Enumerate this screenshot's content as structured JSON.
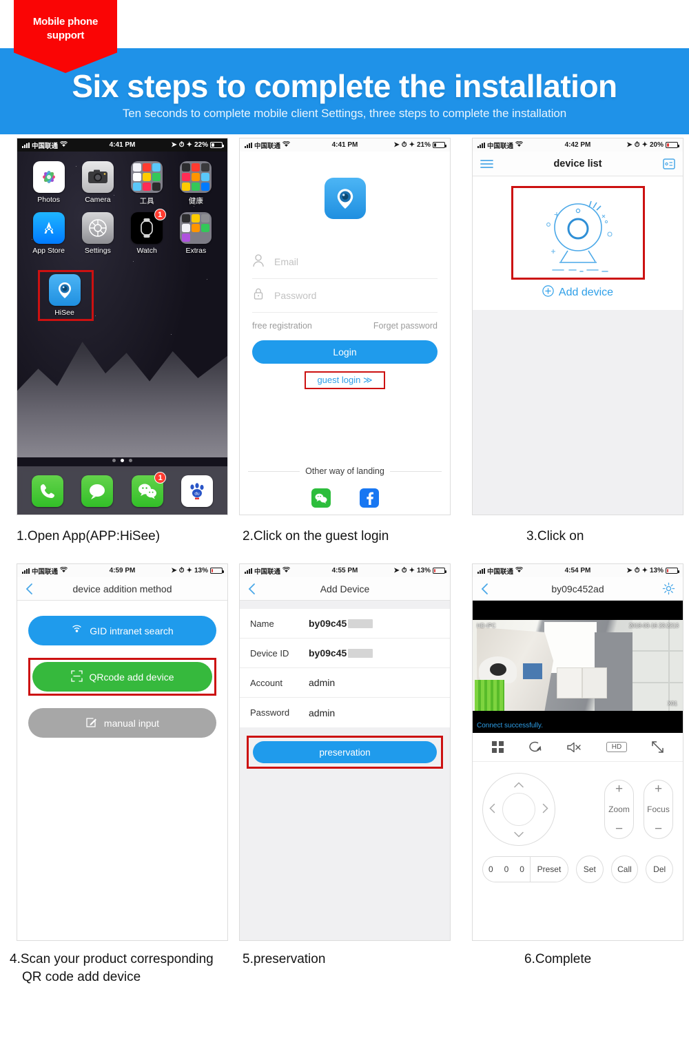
{
  "banner": {
    "ribbon_line1": "Mobile phone",
    "ribbon_line2": "support",
    "title": "Six steps to complete the installation",
    "subtitle": "Ten seconds to complete mobile client Settings, three steps to complete the installation",
    "blue": "#1f92e8",
    "red": "#fa0505"
  },
  "captions": {
    "step1": "1.Open App(APP:HiSee)",
    "step2": "2.Click on the guest login",
    "step3": "3.Click on",
    "step4_line1": "4.Scan your product corresponding",
    "step4_line2": "QR code add device",
    "step5": "5.preservation",
    "step6": "6.Complete"
  },
  "phone1": {
    "status": {
      "carrier": "中国联通",
      "time": "4:41 PM",
      "battery": "22%"
    },
    "apps_row1": [
      {
        "label": "Photos",
        "icon": "photos-icon"
      },
      {
        "label": "Camera",
        "icon": "camera-icon"
      },
      {
        "label": "工具",
        "icon": "folder-icon"
      },
      {
        "label": "健康",
        "icon": "folder-icon"
      }
    ],
    "apps_row2": [
      {
        "label": "App Store",
        "icon": "app-store-icon"
      },
      {
        "label": "Settings",
        "icon": "settings-icon"
      },
      {
        "label": "Watch",
        "icon": "watch-icon",
        "badge": "1"
      },
      {
        "label": "Extras",
        "icon": "folder-icon"
      }
    ],
    "highlighted_app": {
      "label": "HiSee",
      "icon": "hisee-icon"
    },
    "dock": [
      {
        "label": "Phone",
        "icon": "phone-icon"
      },
      {
        "label": "Messages",
        "icon": "messages-icon"
      },
      {
        "label": "WeChat",
        "icon": "wechat-icon",
        "badge": "1"
      },
      {
        "label": "Baidu",
        "icon": "baidu-icon"
      }
    ]
  },
  "phone2": {
    "status": {
      "carrier": "中国联通",
      "time": "4:41 PM",
      "battery": "21%"
    },
    "email_placeholder": "Email",
    "password_placeholder": "Password",
    "free_registration": "free registration",
    "forget_password": "Forget password",
    "login_button": "Login",
    "guest_login": "guest login",
    "guest_chevron": "≫",
    "other_way": "Other way of landing",
    "socials": [
      {
        "name": "wechat-icon"
      },
      {
        "name": "facebook-icon"
      }
    ]
  },
  "phone3": {
    "status": {
      "carrier": "中国联通",
      "time": "4:42 PM",
      "battery": "20%"
    },
    "nav_title": "device list",
    "menu_icon": "hamburger-icon",
    "right_icon": "list-view-icon",
    "add_device": "Add device"
  },
  "phone4": {
    "status": {
      "carrier": "中国联通",
      "time": "4:59 PM",
      "battery": "13%"
    },
    "nav_title": "device addition method",
    "back_icon": "back-chevron-icon",
    "buttons": [
      {
        "label": "GID intranet search",
        "icon": "wifi-signal-icon",
        "color": "#1f9bec"
      },
      {
        "label": "QRcode add device",
        "icon": "qr-scan-icon",
        "color": "#36b93d"
      },
      {
        "label": "manual input",
        "icon": "pencil-square-icon",
        "color": "#a7a7a7"
      }
    ]
  },
  "phone5": {
    "status": {
      "carrier": "中国联通",
      "time": "4:55 PM",
      "battery": "13%"
    },
    "nav_title": "Add Device",
    "back_icon": "back-chevron-icon",
    "fields": [
      {
        "key": "Name",
        "value": "by09c45",
        "redacted": true
      },
      {
        "key": "Device ID",
        "value": "by09c45",
        "redacted": true
      },
      {
        "key": "Account",
        "value": "admin",
        "redacted": false
      },
      {
        "key": "Password",
        "value": "admin",
        "redacted": false
      }
    ],
    "save_button": "preservation"
  },
  "phone6": {
    "status": {
      "carrier": "中国联通",
      "time": "4:54 PM",
      "battery": "13%"
    },
    "nav_title": "by09c452ad",
    "back_icon": "back-chevron-icon",
    "settings_icon": "gear-icon",
    "video": {
      "label_topleft": "HD-IPC",
      "timestamp": "2018-03-16 23:2213",
      "label_bottomright": "X01",
      "status_text": "Connect successfully."
    },
    "toolbar": [
      {
        "name": "grid-view-icon",
        "label": ""
      },
      {
        "name": "rotate-icon",
        "label": ""
      },
      {
        "name": "mute-speaker-icon",
        "label": ""
      },
      {
        "name": "hd-quality-chip",
        "label": "HD"
      },
      {
        "name": "fullscreen-icon",
        "label": ""
      }
    ],
    "ptz": {
      "zoom_label": "Zoom",
      "focus_label": "Focus",
      "plus": "+",
      "minus": "−",
      "preset_numbers": [
        "0",
        "0",
        "0"
      ],
      "preset_label": "Preset",
      "set": "Set",
      "call": "Call",
      "del": "Del"
    },
    "page_dots": 3,
    "active_dot": 2
  }
}
